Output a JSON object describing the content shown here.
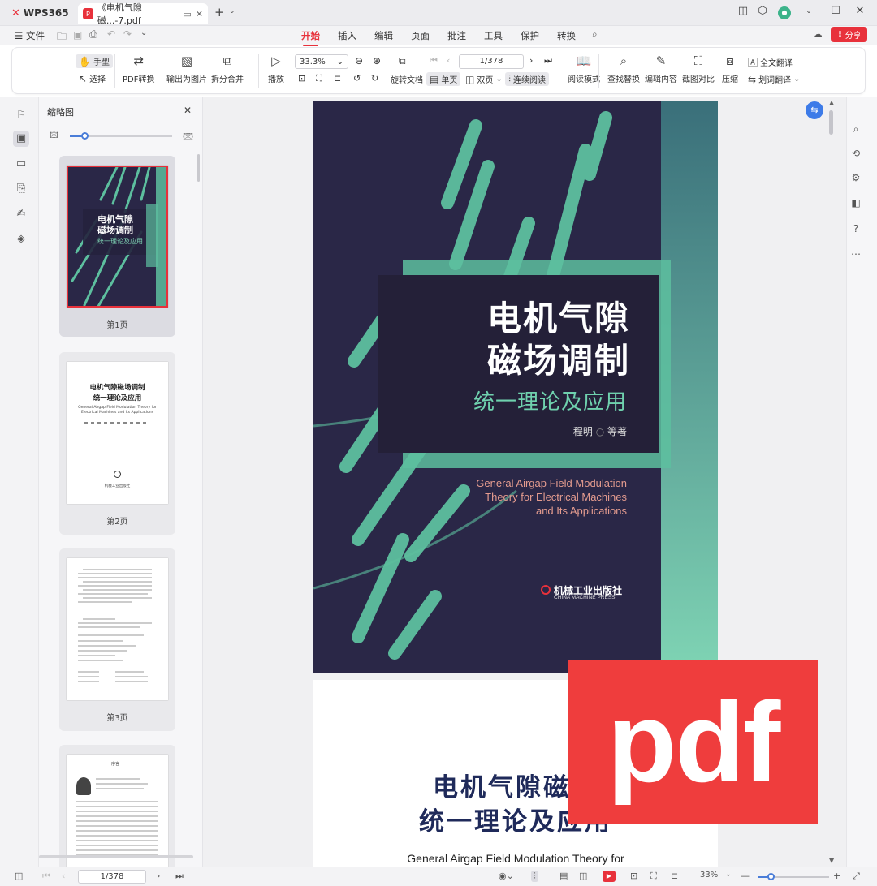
{
  "titlebar": {
    "app_name": "WPS365",
    "doc_tab_title": "《电机气隙磁...-7.pdf",
    "new_tab": "+"
  },
  "menu": {
    "file": "文件",
    "tabs": [
      "开始",
      "插入",
      "编辑",
      "页面",
      "批注",
      "工具",
      "保护",
      "转换"
    ],
    "active_tab": "开始",
    "share": "分享"
  },
  "toolbar": {
    "hand": "手型",
    "select": "选择",
    "pdf_convert": "PDF转换",
    "export_image": "输出为图片",
    "split_merge": "拆分合并",
    "play": "播放",
    "zoom": "33.3%",
    "page": "1/378",
    "rotate": "旋转文档",
    "single": "单页",
    "double": "双页",
    "continuous": "连续阅读",
    "read_mode": "阅读模式",
    "find_replace": "查找替换",
    "edit_content": "编辑内容",
    "screenshot_compare": "截图对比",
    "compress": "压缩",
    "full_translate": "全文翻译",
    "word_translate": "划词翻译"
  },
  "thumbnail_panel": {
    "title": "缩略图",
    "pages": [
      {
        "label": "第1页",
        "cover_title1": "电机气隙",
        "cover_title2": "磁场调制",
        "cover_sub": "统一理论及应用"
      },
      {
        "label": "第2页",
        "title1": "电机气隙磁场调制",
        "title2": "统一理论及应用",
        "en": "General Airgap Field Modulation Theory for Electrical Machines and Its Applications",
        "publisher": "机械工业出版社"
      },
      {
        "label": "第3页"
      },
      {
        "label": "序言"
      }
    ]
  },
  "cover": {
    "title_line1": "电机气隙",
    "title_line2": "磁场调制",
    "subtitle": "统一理论及应用",
    "author": "程明",
    "author_suffix": "等著",
    "en_line1": "General Airgap Field Modulation",
    "en_line2": "Theory  for Electrical Machines",
    "en_line3": "and Its Applications",
    "publisher_cn": "机械工业出版社",
    "publisher_en": "CHINA MACHINE PRESS"
  },
  "page2": {
    "title_line1": "电机气隙磁场",
    "title_line2": "统一理论及应用",
    "en_line": "General Airgap Field Modulation Theory for"
  },
  "watermark": {
    "text": "pdf"
  },
  "statusbar": {
    "page": "1/378",
    "zoom": "33%"
  },
  "colors": {
    "accent": "#e8313b",
    "cover_bg": "#2a2747",
    "cover_green": "#5dbf9f"
  }
}
